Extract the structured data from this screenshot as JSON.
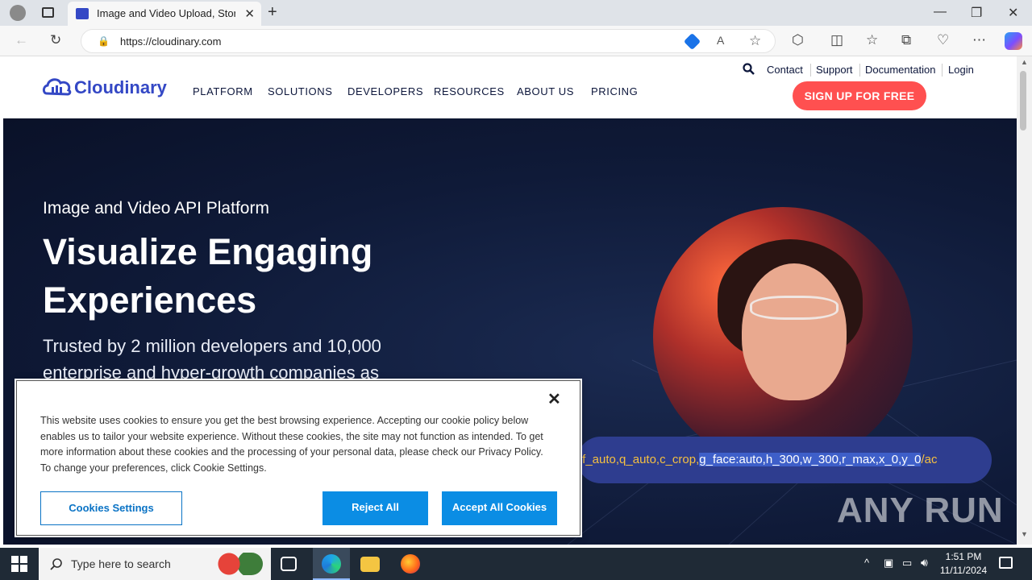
{
  "browser": {
    "tab_title": "Image and Video Upload, Storage,",
    "url": "https://cloudinary.com",
    "close_glyph": "✕",
    "new_tab_glyph": "+"
  },
  "header": {
    "logo_text": "Cloudinary",
    "nav": [
      "PLATFORM",
      "SOLUTIONS",
      "DEVELOPERS",
      "RESOURCES",
      "ABOUT US",
      "PRICING"
    ],
    "utility": [
      "Contact",
      "Support",
      "Documentation",
      "Login"
    ],
    "signup": "SIGN UP FOR FREE"
  },
  "hero": {
    "eyebrow": "Image and Video API Platform",
    "title": "Visualize Engaging Experiences",
    "subtitle": "Trusted by 2 million developers and 10,000 enterprise and hyper-growth companies as",
    "url_prefix": "/f_auto,q_auto,c_crop,",
    "url_highlight": "g_face:auto,h_300,w_300,r_max,x_0,y_0",
    "url_suffix": "/ac"
  },
  "cookie": {
    "close": "✕",
    "text": "This website uses cookies to ensure you get the best browsing experience. Accepting our cookie policy below enables us to tailor your website experience. Without these cookies, the site may not function as intended. To get more information about these cookies and the processing of your personal data, please check our Privacy Policy. To change your preferences, click Cookie Settings.",
    "settings": "Cookies Settings",
    "reject": "Reject All",
    "accept": "Accept All Cookies"
  },
  "watermark": "ANY RUN",
  "taskbar": {
    "search_placeholder": "Type here to search",
    "time": "1:51 PM",
    "date": "11/11/2024"
  },
  "colors": {
    "brand": "#3448c5",
    "cta": "#ff5050",
    "cookie_btn": "#0b8de4"
  }
}
